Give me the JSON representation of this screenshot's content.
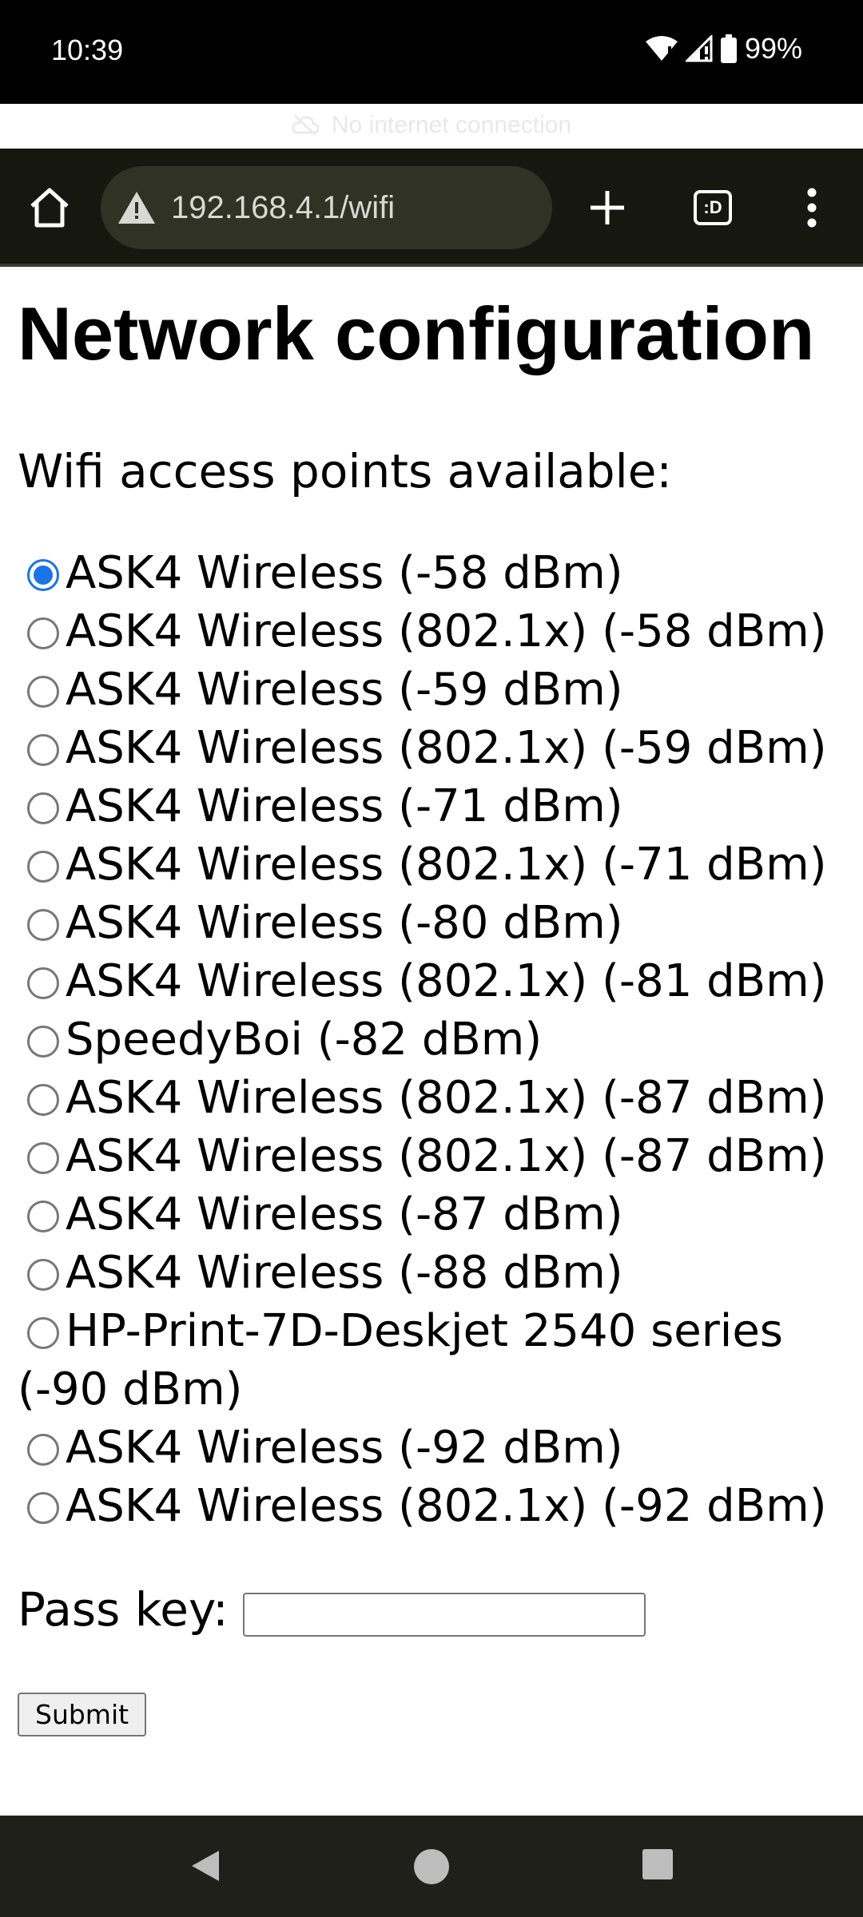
{
  "status": {
    "time": "10:39",
    "battery": "99%",
    "banner": "No internet connection"
  },
  "browser": {
    "url": "192.168.4.1/wifi",
    "tab_count": ":D"
  },
  "page": {
    "title": "Network configuration",
    "subtitle": "Wifi access points available:",
    "access_points": [
      {
        "label": "ASK4 Wireless (-58 dBm)",
        "checked": true
      },
      {
        "label": "ASK4 Wireless (802.1x) (-58 dBm)",
        "checked": false
      },
      {
        "label": "ASK4 Wireless (-59 dBm)",
        "checked": false
      },
      {
        "label": "ASK4 Wireless (802.1x) (-59 dBm)",
        "checked": false
      },
      {
        "label": "ASK4 Wireless (-71 dBm)",
        "checked": false
      },
      {
        "label": "ASK4 Wireless (802.1x) (-71 dBm)",
        "checked": false
      },
      {
        "label": "ASK4 Wireless (-80 dBm)",
        "checked": false
      },
      {
        "label": "ASK4 Wireless (802.1x) (-81 dBm)",
        "checked": false
      },
      {
        "label": "SpeedyBoi (-82 dBm)",
        "checked": false
      },
      {
        "label": "ASK4 Wireless (802.1x) (-87 dBm)",
        "checked": false
      },
      {
        "label": "ASK4 Wireless (802.1x) (-87 dBm)",
        "checked": false
      },
      {
        "label": "ASK4 Wireless (-87 dBm)",
        "checked": false
      },
      {
        "label": "ASK4 Wireless (-88 dBm)",
        "checked": false
      },
      {
        "label": "HP-Print-7D-Deskjet 2540 series (-90 dBm)",
        "checked": false
      },
      {
        "label": "ASK4 Wireless (-92 dBm)",
        "checked": false
      },
      {
        "label": "ASK4 Wireless (802.1x) (-92 dBm)",
        "checked": false
      }
    ],
    "pass_key_label": "Pass key:",
    "pass_key_value": "",
    "submit_label": "Submit"
  },
  "colors": {
    "accent": "#1a73e8",
    "toolbar_bg": "#16180f",
    "omnibox_bg": "#2f3225"
  }
}
